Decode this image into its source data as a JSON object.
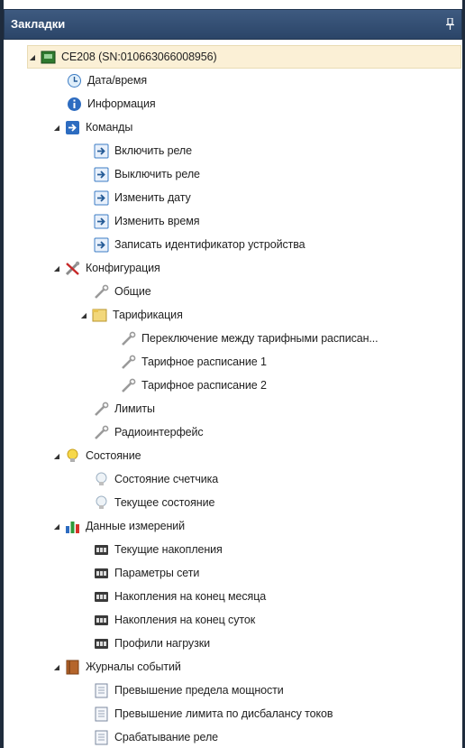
{
  "panel": {
    "title": "Закладки"
  },
  "tree": {
    "device": "CE208 (SN:010663066008956)",
    "datetime": "Дата/время",
    "info": "Информация",
    "commands": {
      "label": "Команды",
      "items": [
        "Включить реле",
        "Выключить реле",
        "Изменить дату",
        "Изменить время",
        "Записать идентификатор устройства"
      ]
    },
    "config": {
      "label": "Конфигурация",
      "general": "Общие",
      "tariff": {
        "label": "Тарификация",
        "items": [
          "Переключение между тарифными расписан...",
          "Тарифное расписание 1",
          "Тарифное расписание 2"
        ]
      },
      "limits": "Лимиты",
      "radio": "Радиоинтерфейс"
    },
    "state": {
      "label": "Состояние",
      "items": [
        "Состояние счетчика",
        "Текущее состояние"
      ]
    },
    "measurements": {
      "label": "Данные измерений",
      "items": [
        "Текущие накопления",
        "Параметры сети",
        "Накопления на конец месяца",
        "Накопления на конец суток",
        "Профили нагрузки"
      ]
    },
    "events": {
      "label": "Журналы событий",
      "items": [
        "Превышение предела мощности",
        "Превышение лимита по дисбалансу токов",
        "Срабатывание реле"
      ]
    }
  },
  "colors": {
    "titlebar": "#2b4568",
    "selected_row": "#fbf0d6"
  }
}
